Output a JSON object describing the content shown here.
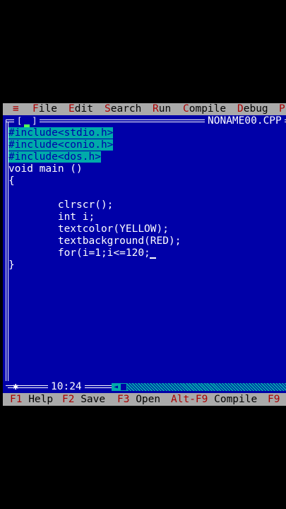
{
  "menu": {
    "system_icon": "≡",
    "items": [
      {
        "hot": "F",
        "rest": "ile"
      },
      {
        "hot": "E",
        "rest": "dit"
      },
      {
        "hot": "S",
        "rest": "earch"
      },
      {
        "hot": "R",
        "rest": "un"
      },
      {
        "hot": "C",
        "rest": "ompile"
      },
      {
        "hot": "D",
        "rest": "ebug"
      },
      {
        "hot": "P",
        "rest": ""
      }
    ]
  },
  "window": {
    "close_icon": "■",
    "filename": "NONAME00.CPP"
  },
  "editor": {
    "lines": [
      {
        "text": "#include<stdio.h>",
        "selected": true
      },
      {
        "text": "#include<conio.h>",
        "selected": true
      },
      {
        "text": "#include<dos.h>",
        "selected": true
      },
      {
        "text": "void main ()",
        "selected": false
      },
      {
        "text": "{",
        "selected": false
      },
      {
        "text": "        clrscr();",
        "selected": false
      },
      {
        "text": "        int i;",
        "selected": false
      },
      {
        "text": "        textcolor(YELLOW);",
        "selected": false
      },
      {
        "text": "        textbackground(RED);",
        "selected": false
      },
      {
        "text": "        for(i=1;i<=120;",
        "selected": false
      },
      {
        "text": "}",
        "selected": false
      }
    ]
  },
  "position": "10:24",
  "status": [
    {
      "key": "F1",
      "label": " Help"
    },
    {
      "key": "F2",
      "label": " Save"
    },
    {
      "key": "F3",
      "label": " Open"
    },
    {
      "key": "Alt-F9",
      "label": " Compile"
    },
    {
      "key": "F9",
      "label": ""
    }
  ],
  "colors": {
    "editor_bg": "#0000a8",
    "menu_bg": "#aaaaaa",
    "hotkey": "#aa0000",
    "selection": "#00aaaa"
  }
}
